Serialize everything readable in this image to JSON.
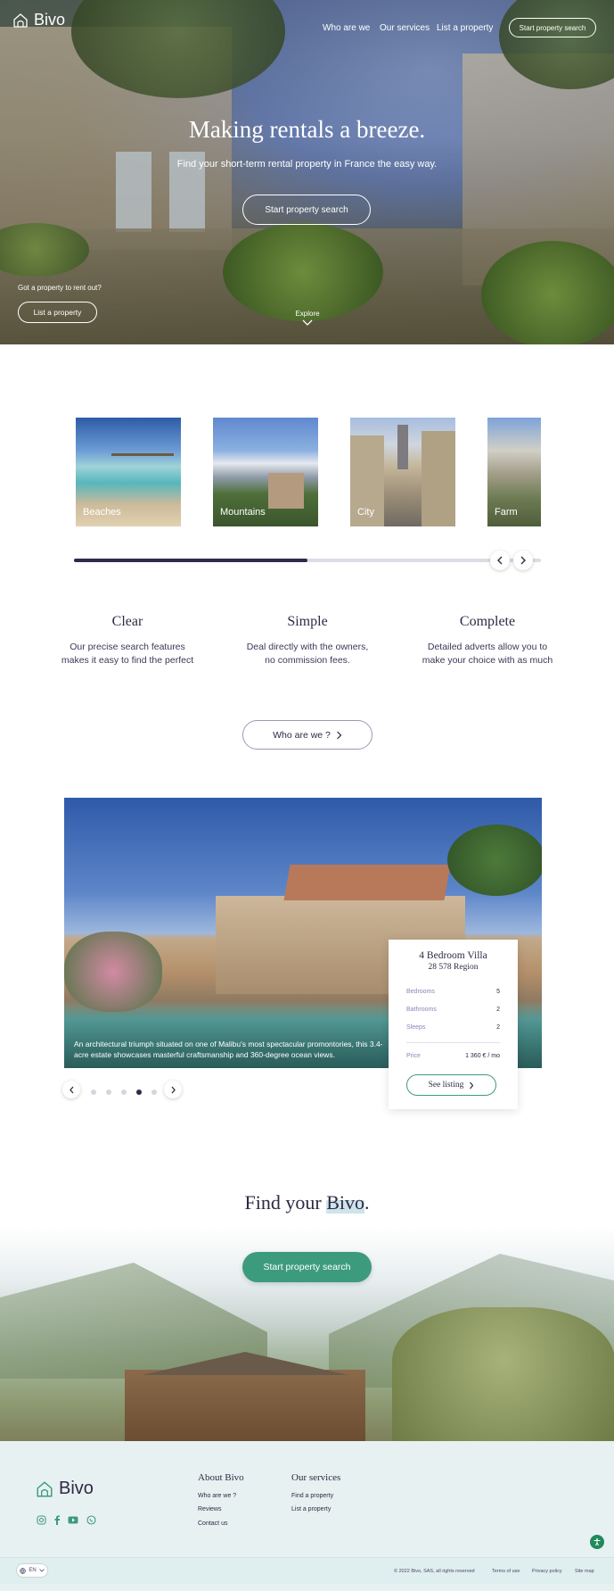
{
  "brand": {
    "name": "Bivo"
  },
  "nav": {
    "who": "Who are we",
    "services": "Our services",
    "list": "List a property",
    "search_btn": "Start property search"
  },
  "hero": {
    "title": "Making rentals a breeze.",
    "subtitle": "Find your short-term rental property in France the easy way.",
    "cta": "Start property search",
    "owner_prompt": "Got a property to rent out?",
    "owner_btn": "List a property",
    "explore": "Explore"
  },
  "categories": {
    "items": [
      {
        "label": "Beaches"
      },
      {
        "label": "Mountains"
      },
      {
        "label": "City"
      },
      {
        "label": "Farm"
      }
    ],
    "progress": 0.5
  },
  "features": [
    {
      "title": "Clear",
      "text": "Our precise search features makes it easy to find the perfect"
    },
    {
      "title": "Simple",
      "text": "Deal directly with the owners, no commission fees."
    },
    {
      "title": "Complete",
      "text": "Detailed adverts allow you to make your choice with as much"
    }
  ],
  "who_btn": "Who are we ?",
  "listing": {
    "caption": "An architectural triumph situated on one of Malibu's most spectacular promontories, this 3.4-acre estate showcases masterful craftsmanship and 360-degree ocean views.",
    "title": "4 Bedroom Villa",
    "region": "28 578 Region",
    "rows": [
      {
        "k": "Bedrooms",
        "v": "5"
      },
      {
        "k": "Bathrooms",
        "v": "2"
      },
      {
        "k": "Sleeps",
        "v": "2"
      }
    ],
    "price_label": "Price",
    "price": "1 360 € / mo",
    "see_btn": "See listing",
    "active_dot": 3,
    "dot_count": 5
  },
  "find": {
    "title_a": "Find your ",
    "title_b": "Bivo",
    "title_c": ".",
    "cta": "Start property search"
  },
  "footer": {
    "about_h": "About Bivo",
    "about_links": [
      "Who are we ?",
      "Reviews",
      "Contact us"
    ],
    "services_h": "Our services",
    "services_links": [
      "Find a property",
      "List a property"
    ],
    "copyright": "© 2022 Bivo, SAS, all rights reserved",
    "terms": "Terms of use",
    "privacy": "Privacy policy",
    "sitemap": "Site map",
    "lang": "EN"
  },
  "colors": {
    "accent": "#3d9b7d",
    "ink": "#2d2a45",
    "footer_bg": "#e8f1f1"
  }
}
